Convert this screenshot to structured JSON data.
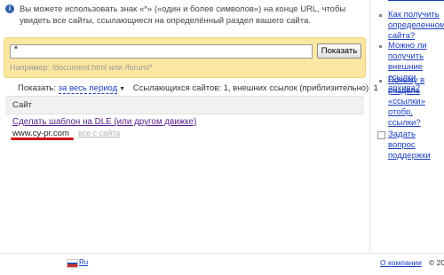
{
  "info": {
    "icon": "info-icon",
    "text": "Вы можете использовать знак «*» («один и более символов») на конце URL, чтобы увидеть все сайты, ссылающиеся на определённый раздел вашего сайта."
  },
  "search": {
    "value": "*",
    "button_label": "Показать",
    "hint": "Например: /document.html или /forum/*"
  },
  "filter": {
    "show_label": "Показать:",
    "period_label": "за весь период",
    "arrow": "▼",
    "stats": "Ссылающихся сайтов: 1, внешних ссылок (приблизительно): 1"
  },
  "table": {
    "header": "Сайт",
    "rows": [
      {
        "title": "Сделать шаблон на DLE (или другом движке)",
        "url": "www.cy-pr.com",
        "all_link": "все с сайта"
      }
    ]
  },
  "sidebar": {
    "items": [
      "Как получить\nопределенном\nсайта?",
      "Можно ли получить\nвнешние ссылки\nархива?",
      "Почему в разделе\n«ссылки» отобр.\nссылки?"
    ],
    "help": "Задать вопрос\nподдержки"
  },
  "footer": {
    "lang": "Ru",
    "about": "О компании",
    "copyright": "© 20"
  },
  "colors": {
    "accent_link": "#1a3dc1",
    "visited_link": "#551a8b",
    "search_bg": "#fbe7a1",
    "highlight": "#d61414"
  }
}
